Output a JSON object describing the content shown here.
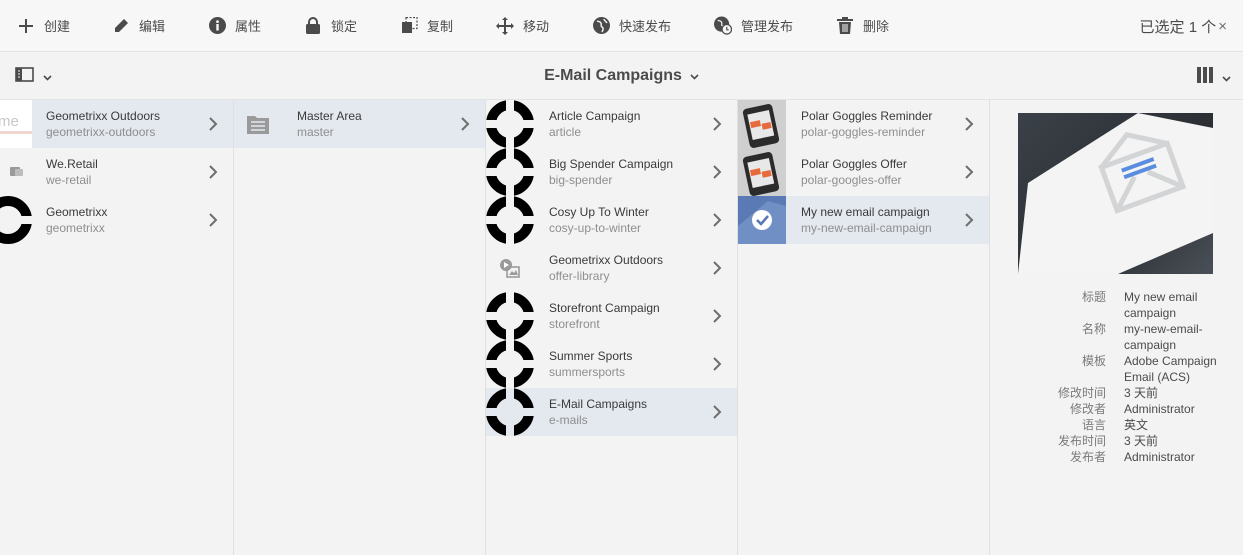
{
  "actionbar": {
    "actions": [
      {
        "icon": "plus-icon",
        "label": "创建"
      },
      {
        "icon": "pencil-icon",
        "label": "编辑"
      },
      {
        "icon": "info-icon",
        "label": "属性"
      },
      {
        "icon": "lock-icon",
        "label": "锁定"
      },
      {
        "icon": "copy-icon",
        "label": "复制"
      },
      {
        "icon": "move-icon",
        "label": "移动"
      },
      {
        "icon": "globe-icon",
        "label": "快速发布"
      },
      {
        "icon": "globe-clock-icon",
        "label": "管理发布"
      },
      {
        "icon": "trash-icon",
        "label": "删除"
      }
    ],
    "selected_text": "已选定 1 个",
    "close_glyph": "×"
  },
  "titlebar": {
    "title": "E-Mail Campaigns"
  },
  "columns": {
    "col1": [
      {
        "title": "Geometrixx Outdoors",
        "name": "geometrixx-outdoors",
        "thumb": "logo",
        "active": true
      },
      {
        "title": "We.Retail",
        "name": "we-retail",
        "thumb": "chat",
        "active": false
      },
      {
        "title": "Geometrixx",
        "name": "geometrixx",
        "thumb": "ring",
        "active": false
      }
    ],
    "col2": [
      {
        "title": "Master Area",
        "name": "master",
        "thumb": "folder",
        "active": true
      }
    ],
    "col3": [
      {
        "title": "Article Campaign",
        "name": "article",
        "thumb": "ring",
        "active": false
      },
      {
        "title": "Big Spender Campaign",
        "name": "big-spender",
        "thumb": "ring",
        "active": false
      },
      {
        "title": "Cosy Up To Winter",
        "name": "cosy-up-to-winter",
        "thumb": "ring",
        "active": false
      },
      {
        "title": "Geometrixx Outdoors",
        "name": "offer-library",
        "thumb": "offer",
        "active": false
      },
      {
        "title": "Storefront Campaign",
        "name": "storefront",
        "thumb": "ring",
        "active": false
      },
      {
        "title": "Summer Sports",
        "name": "summersports",
        "thumb": "ring",
        "active": false
      },
      {
        "title": "E-Mail Campaigns",
        "name": "e-mails",
        "thumb": "ring",
        "active": true
      }
    ],
    "col4": [
      {
        "title": "Polar Goggles Reminder",
        "name": "polar-goggles-reminder",
        "thumb": "phone",
        "active": false
      },
      {
        "title": "Polar Goggles Offer",
        "name": "polar-googles-offer",
        "thumb": "phone",
        "active": false
      },
      {
        "title": "My new email campaign",
        "name": "my-new-email-campaign",
        "thumb": "check",
        "active": true
      }
    ]
  },
  "preview": {
    "meta": [
      {
        "label": "标题",
        "value": "My new email campaign"
      },
      {
        "label": "名称",
        "value": "my-new-email-campaign"
      },
      {
        "label": "模板",
        "value": "Adobe Campaign Email (ACS)"
      },
      {
        "label": "修改时间",
        "value": "3 天前"
      },
      {
        "label": "修改者",
        "value": "Administrator"
      },
      {
        "label": "语言",
        "value": "英文"
      },
      {
        "label": "发布时间",
        "value": "3 天前"
      },
      {
        "label": "发布者",
        "value": "Administrator"
      }
    ]
  },
  "colors": {
    "active_row": "#e4e9f0",
    "background": "#f3f3f3",
    "selected_thumb": "#5a7ab5"
  }
}
